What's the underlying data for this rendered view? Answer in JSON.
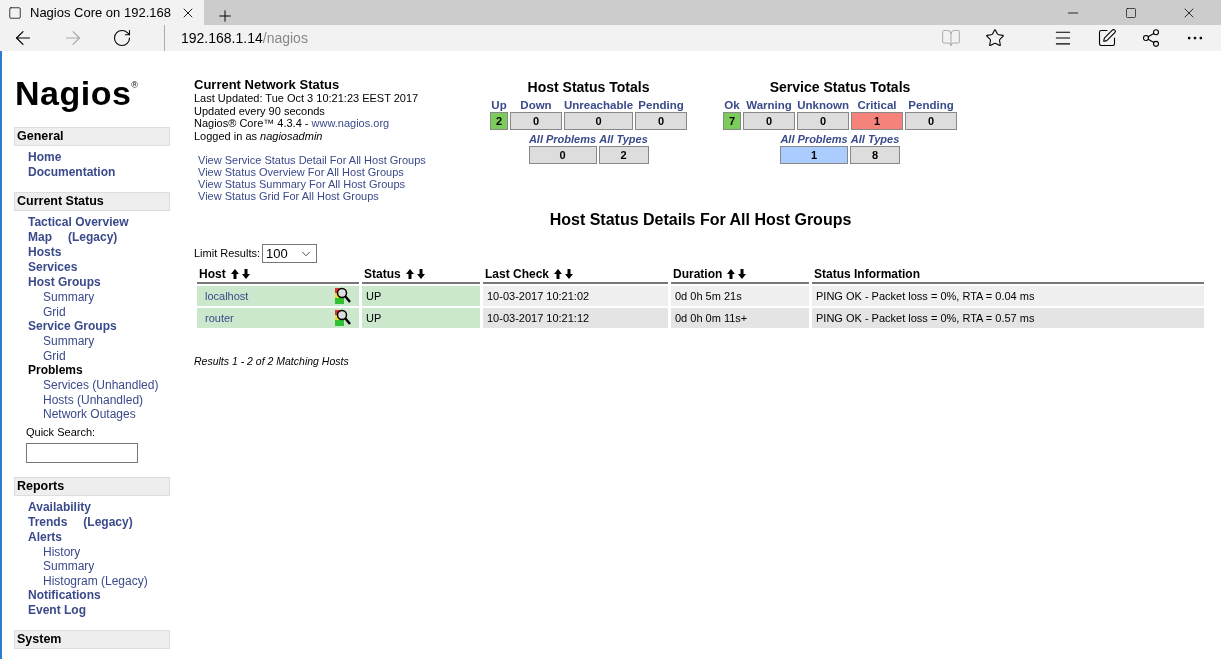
{
  "browser": {
    "tab_title": "Nagios Core on 192.168",
    "address_host": "192.168.1.14",
    "address_path": "/nagios"
  },
  "logo": {
    "text": "Nagios",
    "mark": "®"
  },
  "sidebar": [
    {
      "title": "General",
      "items": [
        {
          "label": "Home",
          "kind": "link"
        },
        {
          "label": "Documentation",
          "kind": "link"
        }
      ]
    },
    {
      "title": "Current Status",
      "items": [
        {
          "label": "Tactical Overview",
          "kind": "link"
        },
        {
          "label": "Map",
          "suffix": "(Legacy)",
          "kind": "link"
        },
        {
          "label": "Hosts",
          "kind": "link"
        },
        {
          "label": "Services",
          "kind": "link"
        },
        {
          "label": "Host Groups",
          "kind": "link",
          "children": [
            {
              "label": "Summary"
            },
            {
              "label": "Grid"
            }
          ]
        },
        {
          "label": "Service Groups",
          "kind": "link",
          "children": [
            {
              "label": "Summary"
            },
            {
              "label": "Grid"
            }
          ]
        },
        {
          "label": "Problems",
          "kind": "label",
          "children": [
            {
              "label": "Services (Unhandled)"
            },
            {
              "label": "Hosts (Unhandled)"
            },
            {
              "label": "Network Outages"
            }
          ]
        }
      ],
      "search": {
        "label": "Quick Search:"
      }
    },
    {
      "title": "Reports",
      "items": [
        {
          "label": "Availability",
          "kind": "link"
        },
        {
          "label": "Trends",
          "suffix": "(Legacy)",
          "kind": "link"
        },
        {
          "label": "Alerts",
          "kind": "link",
          "children": [
            {
              "label": "History"
            },
            {
              "label": "Summary"
            },
            {
              "label": "Histogram (Legacy)"
            }
          ]
        },
        {
          "label": "Notifications",
          "kind": "link"
        },
        {
          "label": "Event Log",
          "kind": "link"
        }
      ]
    },
    {
      "title": "System"
    }
  ],
  "network_status": {
    "title": "Current Network Status",
    "last_updated": "Last Updated: Tue Oct 3 10:21:23 EEST 2017",
    "update_interval": "Updated every 90 seconds",
    "version": "Nagios® Core™ 4.3.4 - ",
    "version_link": "www.nagios.org",
    "logged_in": "Logged in as ",
    "user": "nagiosadmin",
    "links": [
      "View Service Status Detail For All Host Groups",
      "View Status Overview For All Host Groups",
      "View Status Summary For All Host Groups",
      "View Status Grid For All Host Groups"
    ]
  },
  "host_totals": {
    "title": "Host Status Totals",
    "items": [
      {
        "label": "Up",
        "value": "2",
        "color": "#7ccc5c"
      },
      {
        "label": "Down",
        "value": "0",
        "color": "#dddddd"
      },
      {
        "label": "Unreachable",
        "value": "0",
        "color": "#dddddd"
      },
      {
        "label": "Pending",
        "value": "0",
        "color": "#dddddd"
      }
    ],
    "summary": [
      {
        "label": "All Problems",
        "value": "0",
        "color": "#dddddd"
      },
      {
        "label": "All Types",
        "value": "2",
        "color": "#dddddd"
      }
    ]
  },
  "service_totals": {
    "title": "Service Status Totals",
    "items": [
      {
        "label": "Ok",
        "value": "7",
        "color": "#7ccc5c"
      },
      {
        "label": "Warning",
        "value": "0",
        "color": "#dddddd"
      },
      {
        "label": "Unknown",
        "value": "0",
        "color": "#dddddd"
      },
      {
        "label": "Critical",
        "value": "1",
        "color": "#f5837c"
      },
      {
        "label": "Pending",
        "value": "0",
        "color": "#dddddd"
      }
    ],
    "summary": [
      {
        "label": "All Problems",
        "value": "1",
        "color": "#aaccff"
      },
      {
        "label": "All Types",
        "value": "8",
        "color": "#dddddd"
      }
    ]
  },
  "page_title": "Host Status Details For All Host Groups",
  "limit": {
    "label": "Limit Results:",
    "value": "100"
  },
  "table": {
    "columns": [
      {
        "label": "Host",
        "sortable": true
      },
      {
        "label": "Status",
        "sortable": true
      },
      {
        "label": "Last Check",
        "sortable": true
      },
      {
        "label": "Duration",
        "sortable": true
      },
      {
        "label": "Status Information",
        "sortable": false
      }
    ],
    "rows": [
      {
        "host": "localhost",
        "status": "UP",
        "color": "#cce8cc",
        "last_check": "10-03-2017 10:21:02",
        "duration": "0d 0h 5m 21s",
        "info": "PING OK - Packet loss = 0%, RTA = 0.04 ms"
      },
      {
        "host": "router",
        "status": "UP",
        "color": "#cce8cc",
        "last_check": "10-03-2017 10:21:12",
        "duration": "0d 0h 0m 11s+",
        "info": "PING OK - Packet loss = 0%, RTA = 0.57 ms"
      }
    ]
  },
  "results": "Results 1 - 2 of 2 Matching Hosts"
}
